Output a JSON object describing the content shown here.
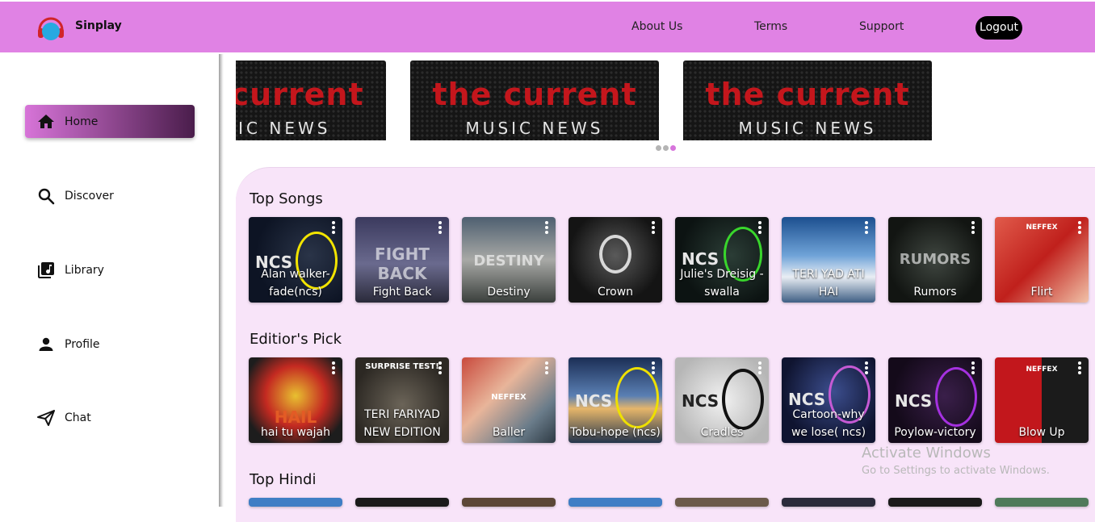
{
  "header": {
    "brand": "Sinplay",
    "links": {
      "about": "About Us",
      "terms": "Terms",
      "support": "Support"
    },
    "logout_label": "Logout",
    "color": "#e082e4"
  },
  "sidebar": {
    "items": [
      {
        "label": "Home",
        "icon": "home-icon",
        "active": true
      },
      {
        "label": "Discover",
        "icon": "search-icon"
      },
      {
        "label": "Library",
        "icon": "library-music-icon"
      },
      {
        "label": "Profile",
        "icon": "person-icon"
      },
      {
        "label": "Chat",
        "icon": "send-icon"
      }
    ]
  },
  "banner": {
    "line1": "the current",
    "line2": "MUSIC NEWS",
    "slides": 3,
    "active_dot": 3
  },
  "sections": [
    {
      "title": "Top Songs",
      "cards": [
        {
          "title": "Alan walker-fade(ncs)"
        },
        {
          "title": "Fight Back",
          "art_text": "FIGHT BACK"
        },
        {
          "title": "Destiny",
          "art_text": "DESTINY"
        },
        {
          "title": "Crown"
        },
        {
          "title": "Julie's Dreisig - swalla"
        },
        {
          "title": "TERI YAD ATI HAI"
        },
        {
          "title": "Rumors",
          "art_text": "RUMORS"
        },
        {
          "title": "Flirt",
          "art_text": "NEFFEX"
        }
      ]
    },
    {
      "title": "Editior's Pick",
      "cards": [
        {
          "title": "hai tu wajah",
          "art_text": "HAIL"
        },
        {
          "title": "TERI FARIYAD NEW EDITION",
          "art_text": "SURPRISE TEST!"
        },
        {
          "title": "Baller",
          "art_text": "NEFFEX"
        },
        {
          "title": "Tobu-hope (ncs)"
        },
        {
          "title": "Cradles"
        },
        {
          "title": "Cartoon-why we lose( ncs)"
        },
        {
          "title": "Poylow-victory"
        },
        {
          "title": "Blow Up",
          "art_text": "NEFFEX"
        }
      ]
    },
    {
      "title": "Top Hindi",
      "cards": []
    }
  ],
  "watermark": {
    "line1": "Activate Windows",
    "line2": "Go to Settings to activate Windows."
  },
  "logo_text": "NCS"
}
